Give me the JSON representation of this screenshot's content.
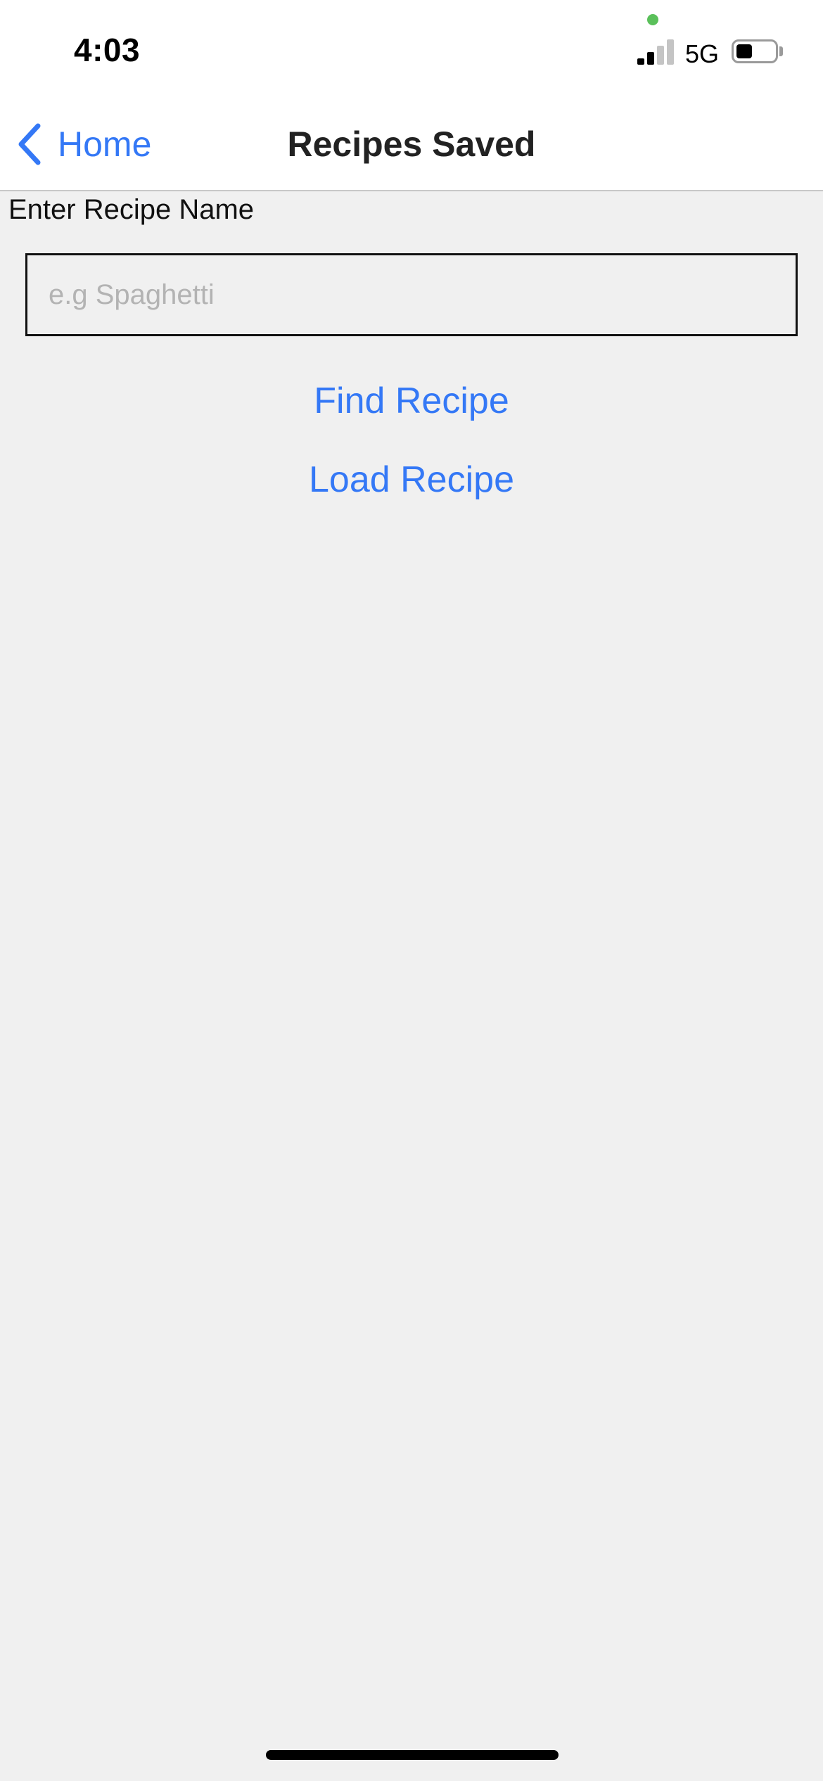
{
  "status_bar": {
    "time": "4:03",
    "network": "5G",
    "signal_bars_active": 2,
    "signal_bars_total": 4,
    "battery_level": 0.4,
    "mic_indicator_color": "#5ac05a"
  },
  "nav": {
    "back_label": "Home",
    "back_icon": "chevron-left-icon",
    "title": "Recipes Saved"
  },
  "form": {
    "label": "Enter Recipe Name",
    "input_value": "",
    "input_placeholder": "e.g Spaghetti"
  },
  "actions": {
    "find_label": "Find Recipe",
    "load_label": "Load Recipe"
  },
  "colors": {
    "accent": "#3478f6",
    "background": "#f0f0f0"
  }
}
